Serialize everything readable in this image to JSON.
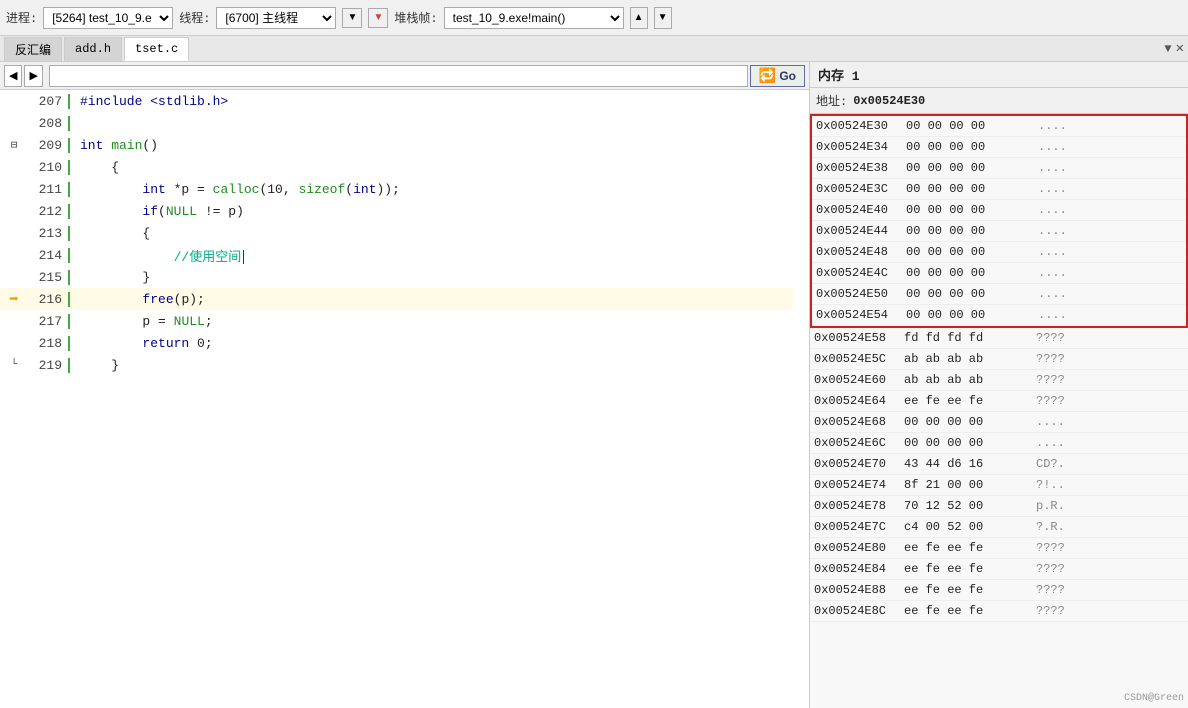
{
  "toolbar": {
    "process_label": "进程:",
    "process_value": "[5264] test_10_9.e",
    "thread_label": "线程:",
    "thread_value": "[6700] 主线程",
    "stack_label": "堆栈帧:",
    "stack_value": "test_10_9.exe!main()",
    "up_btn": "▲"
  },
  "tabs": {
    "items": [
      {
        "label": "反汇编",
        "active": false
      },
      {
        "label": "add.h",
        "active": false
      },
      {
        "label": "tset.c",
        "active": true
      }
    ],
    "close_btn": "✕",
    "arrow_btn": "▼"
  },
  "code_toolbar": {
    "nav_back": "◀",
    "nav_fwd": "▶",
    "addr_placeholder": "",
    "go_label": "Go"
  },
  "code_lines": [
    {
      "num": "207",
      "tokens": [
        {
          "text": "#include <stdlib.h>",
          "cls": "inc-text"
        }
      ],
      "arrow": false
    },
    {
      "num": "208",
      "tokens": [],
      "arrow": false
    },
    {
      "num": "209",
      "tokens": [
        {
          "text": "int",
          "cls": "kw"
        },
        {
          "text": " main()",
          "cls": "fn"
        }
      ],
      "fold": "⊟",
      "arrow": false
    },
    {
      "num": "210",
      "tokens": [
        {
          "text": "    {",
          "cls": "punc"
        }
      ],
      "arrow": false
    },
    {
      "num": "211",
      "tokens": [
        {
          "text": "        "
        },
        {
          "text": "int",
          "cls": "kw"
        },
        {
          "text": " *p = "
        },
        {
          "text": "calloc",
          "cls": "fn"
        },
        {
          "text": "(10, "
        },
        {
          "text": "sizeof",
          "cls": "fn"
        },
        {
          "text": "("
        },
        {
          "text": "int",
          "cls": "kw"
        },
        {
          "text": "));"
        }
      ],
      "arrow": false
    },
    {
      "num": "212",
      "tokens": [
        {
          "text": "        "
        },
        {
          "text": "if",
          "cls": "kw"
        },
        {
          "text": "("
        },
        {
          "text": "NULL",
          "cls": "fn"
        },
        {
          "text": " != p)"
        }
      ],
      "arrow": false
    },
    {
      "num": "213",
      "tokens": [
        {
          "text": "        {",
          "cls": "punc"
        }
      ],
      "arrow": false
    },
    {
      "num": "214",
      "tokens": [
        {
          "text": "            "
        },
        {
          "text": "//使用空间",
          "cls": "comment"
        }
      ],
      "arrow": false,
      "cursor": true
    },
    {
      "num": "215",
      "tokens": [
        {
          "text": "        }",
          "cls": "punc"
        }
      ],
      "arrow": false
    },
    {
      "num": "216",
      "tokens": [
        {
          "text": "        "
        },
        {
          "text": "free",
          "cls": "kw"
        },
        {
          "text": "(p);"
        }
      ],
      "arrow": true
    },
    {
      "num": "217",
      "tokens": [
        {
          "text": "        p = "
        },
        {
          "text": "NULL",
          "cls": "fn"
        },
        {
          "text": ";"
        }
      ],
      "arrow": false
    },
    {
      "num": "218",
      "tokens": [
        {
          "text": "        "
        },
        {
          "text": "return",
          "cls": "kw"
        },
        {
          "text": " 0;"
        }
      ],
      "arrow": false
    },
    {
      "num": "219",
      "tokens": [
        {
          "text": "    }",
          "cls": "punc"
        }
      ],
      "arrow": false,
      "fold_end": "└"
    }
  ],
  "memory": {
    "title": "内存 1",
    "addr_label": "地址:",
    "addr_value": "0x00524E30",
    "rows": [
      {
        "addr": "0x00524E30",
        "bytes": "00 00 00 00",
        "chars": "....",
        "highlight": true
      },
      {
        "addr": "0x00524E34",
        "bytes": "00 00 00 00",
        "chars": "....",
        "highlight": true
      },
      {
        "addr": "0x00524E38",
        "bytes": "00 00 00 00",
        "chars": "....",
        "highlight": true
      },
      {
        "addr": "0x00524E3C",
        "bytes": "00 00 00 00",
        "chars": "....",
        "highlight": true
      },
      {
        "addr": "0x00524E40",
        "bytes": "00 00 00 00",
        "chars": "....",
        "highlight": true
      },
      {
        "addr": "0x00524E44",
        "bytes": "00 00 00 00",
        "chars": "....",
        "highlight": true
      },
      {
        "addr": "0x00524E48",
        "bytes": "00 00 00 00",
        "chars": "....",
        "highlight": true
      },
      {
        "addr": "0x00524E4C",
        "bytes": "00 00 00 00",
        "chars": "....",
        "highlight": true
      },
      {
        "addr": "0x00524E50",
        "bytes": "00 00 00 00",
        "chars": "....",
        "highlight": true
      },
      {
        "addr": "0x00524E54",
        "bytes": "00 00 00 00",
        "chars": "....",
        "highlight": true
      },
      {
        "addr": "0x00524E58",
        "bytes": "fd fd fd fd",
        "chars": "????",
        "highlight": false
      },
      {
        "addr": "0x00524E5C",
        "bytes": "ab ab ab ab",
        "chars": "????",
        "highlight": false
      },
      {
        "addr": "0x00524E60",
        "bytes": "ab ab ab ab",
        "chars": "????",
        "highlight": false
      },
      {
        "addr": "0x00524E64",
        "bytes": "ee fe ee fe",
        "chars": "????",
        "highlight": false
      },
      {
        "addr": "0x00524E68",
        "bytes": "00 00 00 00",
        "chars": "....",
        "highlight": false
      },
      {
        "addr": "0x00524E6C",
        "bytes": "00 00 00 00",
        "chars": "....",
        "highlight": false
      },
      {
        "addr": "0x00524E70",
        "bytes": "43 44 d6 16",
        "chars": "CD?.",
        "highlight": false
      },
      {
        "addr": "0x00524E74",
        "bytes": "8f 21 00 00",
        "chars": "?!..",
        "highlight": false
      },
      {
        "addr": "0x00524E78",
        "bytes": "70 12 52 00",
        "chars": "p.R.",
        "highlight": false
      },
      {
        "addr": "0x00524E7C",
        "bytes": "c4 00 52 00",
        "chars": "?.R.",
        "highlight": false
      },
      {
        "addr": "0x00524E80",
        "bytes": "ee fe ee fe",
        "chars": "????",
        "highlight": false
      },
      {
        "addr": "0x00524E84",
        "bytes": "ee fe ee fe",
        "chars": "????",
        "highlight": false
      },
      {
        "addr": "0x00524E88",
        "bytes": "ee fe ee fe",
        "chars": "????",
        "highlight": false
      },
      {
        "addr": "0x00524E8C",
        "bytes": "ee fe ee fe",
        "chars": "????",
        "highlight": false
      }
    ]
  },
  "watermark": "CSDN@Green"
}
